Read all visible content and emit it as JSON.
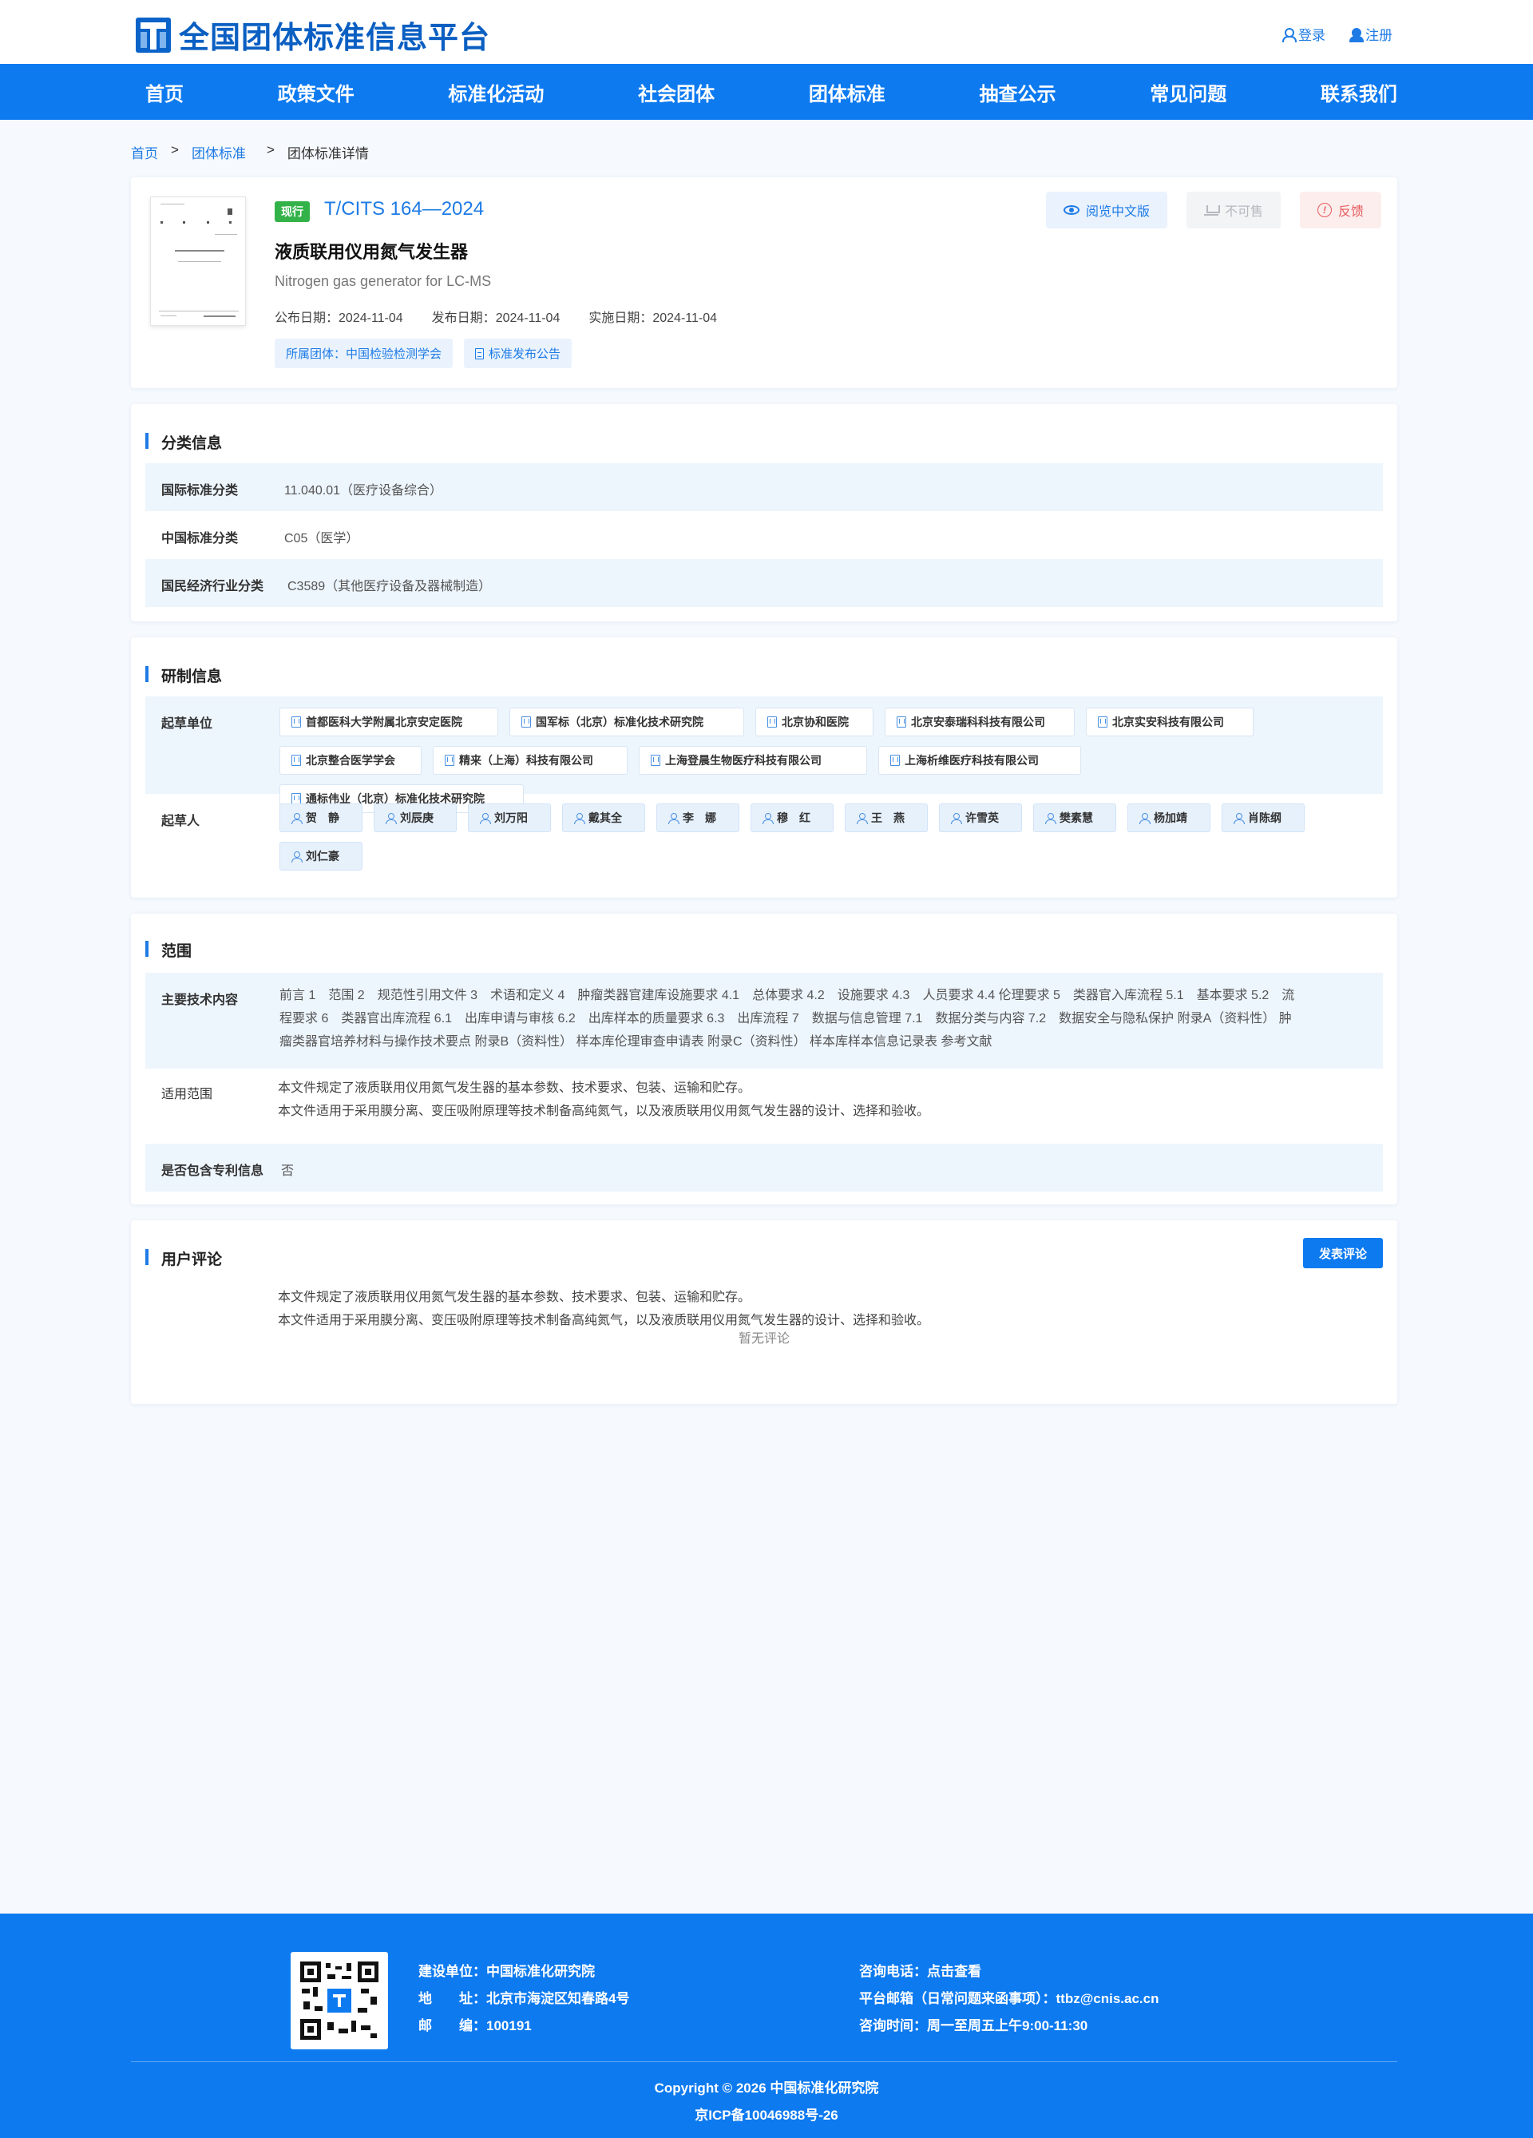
{
  "header": {
    "logo_text": "全国团体标准信息平台",
    "login": "登录",
    "register": "注册"
  },
  "nav": [
    "首页",
    "政策文件",
    "标准化活动",
    "社会团体",
    "团体标准",
    "抽查公示",
    "常见问题",
    "联系我们"
  ],
  "breadcrumb": {
    "home": "首页",
    "sep": ">",
    "section": "团体标准",
    "current": "团体标准详情"
  },
  "standard": {
    "status": "现行",
    "code": "T/CITS 164—2024",
    "title_cn": "液质联用仪用氮气发生器",
    "title_en": "Nitrogen gas generator for LC-MS",
    "dates": [
      {
        "label": "公布日期：",
        "value": "2024-11-04"
      },
      {
        "label": "发布日期：",
        "value": "2024-11-04"
      },
      {
        "label": "实施日期：",
        "value": "2024-11-04"
      }
    ],
    "tag_org": "所属团体：中国检验检测学会",
    "tag_notice": "标准发布公告",
    "btn_view": "阅览中文版",
    "btn_nosale": "不可售",
    "btn_feedback": "反馈"
  },
  "classification": {
    "title": "分类信息",
    "rows": [
      {
        "label": "国际标准分类",
        "value": "11.040.01（医疗设备综合）"
      },
      {
        "label": "中国标准分类",
        "value": "C05（医学）"
      },
      {
        "label": "国民经济行业分类",
        "value": "C3589（其他医疗设备及器械制造）"
      }
    ]
  },
  "drafting": {
    "title": "研制信息",
    "units_label": "起草单位",
    "units": [
      "首都医科大学附属北京安定医院",
      "国军标（北京）标准化技术研究院",
      "北京协和医院",
      "北京安泰瑞科科技有限公司",
      "北京实安科技有限公司",
      "北京整合医学学会",
      "精来（上海）科技有限公司",
      "上海登晨生物医疗科技有限公司",
      "上海析维医疗科技有限公司",
      "通标伟业（北京）标准化技术研究院"
    ],
    "people_label": "起草人",
    "people": [
      "贺　静",
      "刘辰庚",
      "刘万阳",
      "戴其全",
      "李　娜",
      "穆　红",
      "王　燕",
      "许雪英",
      "樊素慧",
      "杨加靖",
      "肖陈纲",
      "刘仁豪"
    ]
  },
  "scope": {
    "title": "范围",
    "tech_label": "主要技术内容",
    "tech_lines": [
      "前言 1　范围 2　规范性引用文件 3　术语和定义 4　肿瘤类器官建库设施要求 4.1　总体要求 4.2　设施要求 4.3　人员要求 4.4 伦理要求 5　类器官入库流程 5.1　基本要求 5.2　流",
      "程要求 6　类器官出库流程 6.1　出库申请与审核 6.2　出库样本的质量要求 6.3　出库流程 7　数据与信息管理 7.1　数据分类与内容 7.2　数据安全与隐私保护 附录A（资料性）  肿",
      "瘤类器官培养材料与操作技术要点 附录B（资料性）  样本库伦理审查申请表 附录C（资料性）  样本库样本信息记录表 参考文献"
    ],
    "applic_label": "适用范围",
    "applic_lines": [
      "本文件规定了液质联用仪用氮气发生器的基本参数、技术要求、包装、运输和贮存。",
      "本文件适用于采用膜分离、变压吸附原理等技术制备高纯氮气，以及液质联用仪用氮气发生器的设计、选择和验收。"
    ],
    "patent_label": "是否包含专利信息",
    "patent_value": "否"
  },
  "comments": {
    "title": "用户评论",
    "button": "发表评论",
    "lines": [
      "本文件规定了液质联用仪用氮气发生器的基本参数、技术要求、包装、运输和贮存。",
      "本文件适用于采用膜分离、变压吸附原理等技术制备高纯氮气，以及液质联用仪用氮气发生器的设计、选择和验收。"
    ],
    "empty": "暂无评论"
  },
  "footer": {
    "builder": "建设单位：中国标准化研究院",
    "address": "地　　址：北京市海淀区知春路4号",
    "postcode": "邮　　编：100191",
    "phone": "咨询电话：点击查看",
    "email": "平台邮箱（日常问题来函事项）：ttbz@cnis.ac.cn",
    "hours": "咨询时间：周一至周五上午9:00-11:30",
    "copyright": "Copyright © 2026 中国标准化研究院",
    "icp": "京ICP备10046988号-26"
  },
  "colors": {
    "primary": "#0d7af0",
    "link": "#1e7be6",
    "status": "#34b24a",
    "feedback": "#e85a5a",
    "shade": "#edf5fd"
  }
}
